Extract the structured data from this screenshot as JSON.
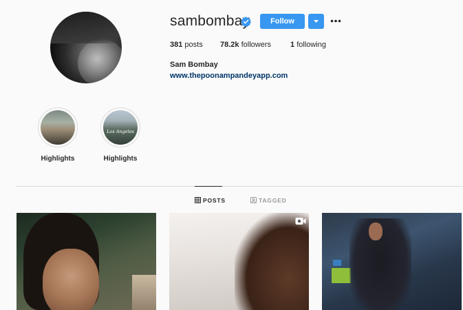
{
  "profile": {
    "username": "sambombay",
    "verified": true,
    "follow_label": "Follow",
    "posts_count": "381",
    "posts_label": "posts",
    "followers_count": "78.2k",
    "followers_label": "followers",
    "following_count": "1",
    "following_label": "following",
    "full_name": "Sam Bombay",
    "website": "www.thepoonampandeyapp.com"
  },
  "highlights": [
    {
      "label": "Highlights",
      "overlay_text": ""
    },
    {
      "label": "Highlights",
      "overlay_text": "Los Angeles"
    }
  ],
  "tabs": [
    {
      "label": "POSTS",
      "icon": "grid-icon",
      "active": true
    },
    {
      "label": "TAGGED",
      "icon": "tag-icon",
      "active": false
    }
  ],
  "colors": {
    "accent": "#3897f0",
    "link": "#003569",
    "text": "#262626",
    "muted": "#999999",
    "background": "#fafafa"
  },
  "posts": [
    {
      "type": "image"
    },
    {
      "type": "video",
      "icon": "video-icon"
    },
    {
      "type": "image"
    }
  ]
}
